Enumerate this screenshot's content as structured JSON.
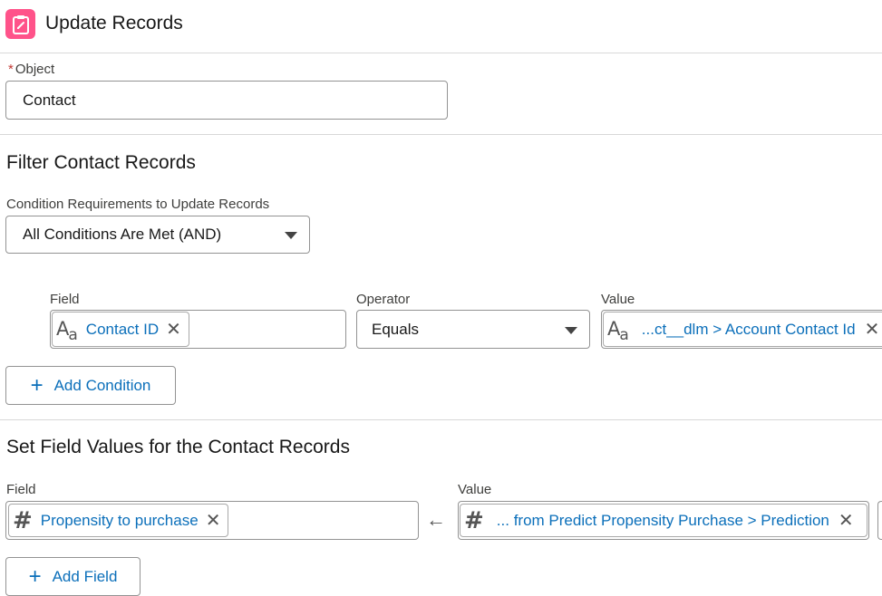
{
  "header": {
    "title": "Update Records",
    "icon": "update-records-icon",
    "icon_color": "#ff538a"
  },
  "object": {
    "required_marker": "*",
    "label": "Object",
    "value": "Contact"
  },
  "filter": {
    "section_title": "Filter Contact Records",
    "condition_label": "Condition Requirements to Update Records",
    "condition_value": "All Conditions Are Met (AND)",
    "columns": {
      "field": "Field",
      "operator": "Operator",
      "value": "Value"
    },
    "row": {
      "field_pill": "Contact ID",
      "operator": "Equals",
      "value_pill": "...ct__dlm > Account Contact Id"
    },
    "add_condition_label": "Add Condition"
  },
  "set_values": {
    "section_title": "Set Field Values for the Contact Records",
    "columns": {
      "field": "Field",
      "value": "Value"
    },
    "row": {
      "field_pill": "Propensity to purchase",
      "arrow": "←",
      "value_pill": "... from Predict Propensity Purchase > Prediction"
    },
    "add_field_label": "Add Field"
  },
  "glyphs": {
    "close": "✕",
    "plus": "+",
    "text_type_a1": "A",
    "text_type_a2": "a",
    "number_type": "#"
  },
  "colors": {
    "link": "#0b6fba",
    "border": "#939393",
    "divider": "#d8d8d8"
  }
}
